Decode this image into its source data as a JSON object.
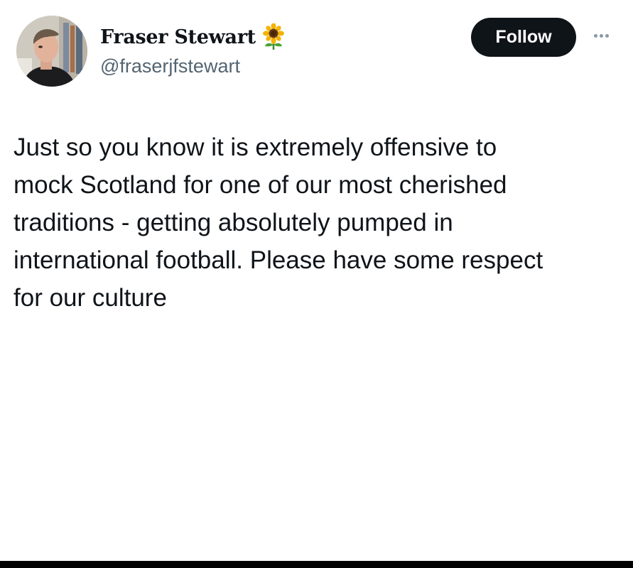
{
  "author": {
    "display_name": "Fraser Stewart",
    "badge_emoji": "sunflower-emoji",
    "handle": "@fraserjfstewart"
  },
  "actions": {
    "follow_label": "Follow",
    "more_icon": "more-options-icon"
  },
  "tweet": {
    "text": "Just so you know it is extremely offensive to\nmock Scotland for one of our most cherished\ntraditions - getting absolutely pumped in\ninternational football. Please have some respect\nfor our culture"
  },
  "colors": {
    "text_primary": "#0f1419",
    "text_secondary": "#536471",
    "follow_bg": "#0f1419",
    "follow_text": "#ffffff",
    "background": "#ffffff"
  }
}
